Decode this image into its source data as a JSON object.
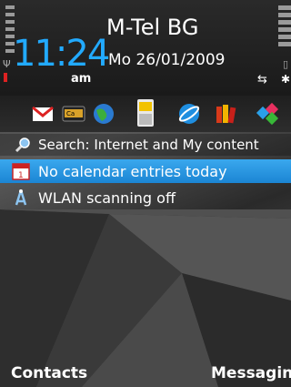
{
  "status": {
    "operator": "M-Tel BG",
    "time": "11:24",
    "ampm": "am",
    "date": "Mo 26/01/2009"
  },
  "shortcuts": [
    {
      "name": "gmail-icon"
    },
    {
      "name": "calculator-icon"
    },
    {
      "name": "globe-icon"
    },
    {
      "name": "contacts-card-icon"
    },
    {
      "name": "browser-icon"
    },
    {
      "name": "books-icon"
    },
    {
      "name": "puzzle-icon"
    }
  ],
  "search": {
    "label": "Search: Internet and My content"
  },
  "calendar": {
    "label": "No calendar entries today"
  },
  "wlan": {
    "label": "WLAN scanning off"
  },
  "softkeys": {
    "left": "Contacts",
    "right": "Messaging"
  },
  "colors": {
    "selection": "#22aaff",
    "clock": "#22aaff"
  }
}
